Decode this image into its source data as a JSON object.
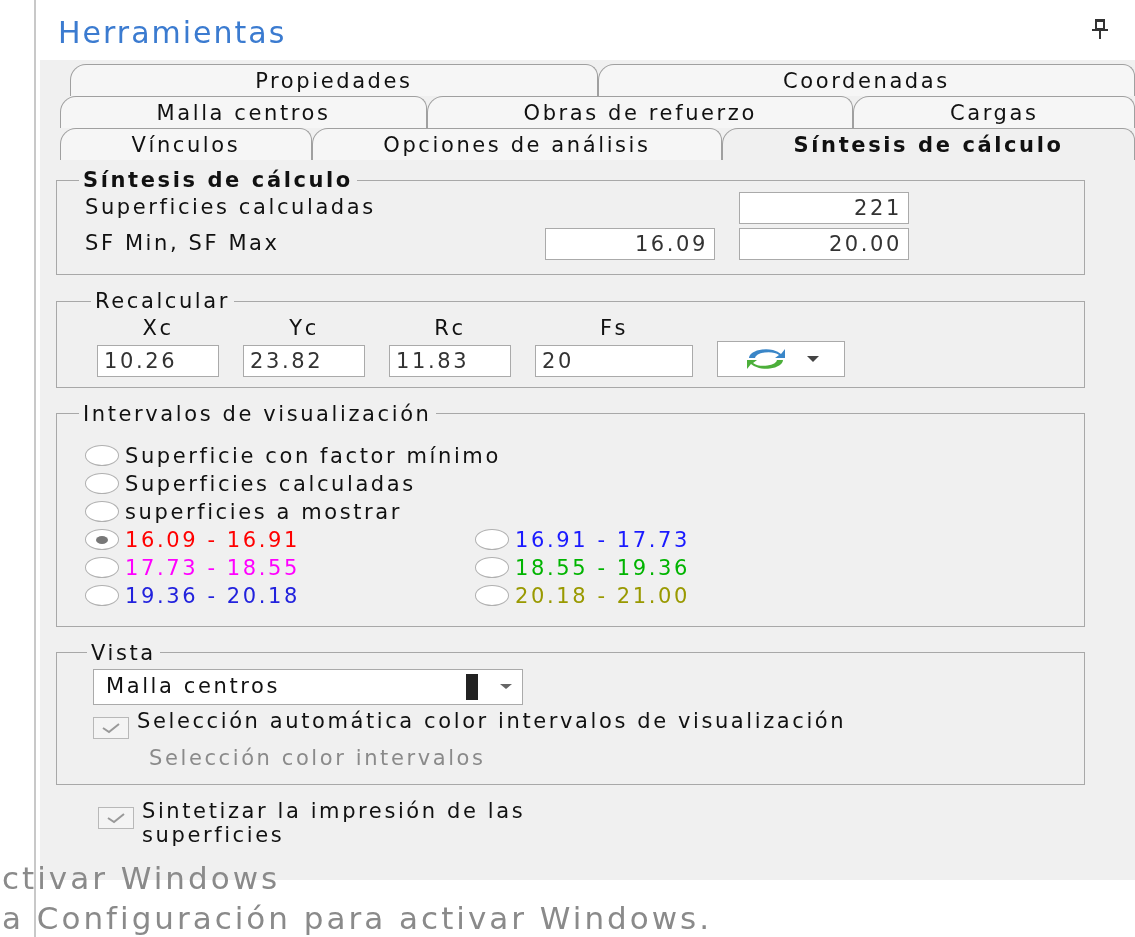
{
  "panel": {
    "title": "Herramientas"
  },
  "tab_rows": [
    {
      "tabs": [
        {
          "label": "Propiedades",
          "selected": false
        },
        {
          "label": "Coordenadas",
          "selected": false
        }
      ]
    },
    {
      "tabs": [
        {
          "label": "Malla centros",
          "selected": false
        },
        {
          "label": "Obras de refuerzo",
          "selected": false
        },
        {
          "label": "Cargas",
          "selected": false
        }
      ]
    },
    {
      "tabs": [
        {
          "label": "Vínculos",
          "selected": false
        },
        {
          "label": "Opciones de análisis",
          "selected": false
        },
        {
          "label": "Síntesis de cálculo",
          "selected": true
        }
      ]
    }
  ],
  "synthesis": {
    "legend": "Síntesis de cálculo",
    "rows": [
      {
        "label": "Superficies calculadas",
        "values": [
          "221"
        ]
      },
      {
        "label": "SF Min, SF Max",
        "values": [
          "16.09",
          "20.00"
        ]
      }
    ]
  },
  "recalculate": {
    "legend": "Recalcular",
    "fields": [
      {
        "label": "Xc",
        "value": "10.26"
      },
      {
        "label": "Yc",
        "value": "23.82"
      },
      {
        "label": "Rc",
        "value": "11.83"
      },
      {
        "label": "Fs",
        "value": "20"
      }
    ]
  },
  "intervals": {
    "legend": "Intervalos de visualización",
    "options": [
      {
        "label": "Superficie con factor mínimo",
        "selected": false
      },
      {
        "label": "Superficies calculadas",
        "selected": false
      },
      {
        "label": "superficies a mostrar",
        "selected": false
      }
    ],
    "ranges": [
      {
        "label": "16.09 - 16.91",
        "selected": true,
        "color": "#ff0000"
      },
      {
        "label": "16.91 - 17.73",
        "selected": false,
        "color": "#1a1aff"
      },
      {
        "label": "17.73 - 18.55",
        "selected": false,
        "color": "#ff00ff"
      },
      {
        "label": "18.55 - 19.36",
        "selected": false,
        "color": "#00b400"
      },
      {
        "label": "19.36 - 20.18",
        "selected": false,
        "color": "#2222dd"
      },
      {
        "label": "20.18 - 21.00",
        "selected": false,
        "color": "#999900"
      }
    ]
  },
  "view": {
    "legend": "Vista",
    "select": {
      "value": "Malla centros"
    },
    "checkbox": {
      "label": "Selección automática color intervalos de visualización",
      "checked": true,
      "disabled": true
    },
    "link": {
      "label": "Selección color intervalos",
      "disabled": true
    }
  },
  "synthesize_print": {
    "label": "Sintetizar la impresión de las superficies",
    "checked": true,
    "disabled": true
  },
  "activation_notice": [
    "ctivar Windows",
    "a Configuración para activar Windows."
  ]
}
